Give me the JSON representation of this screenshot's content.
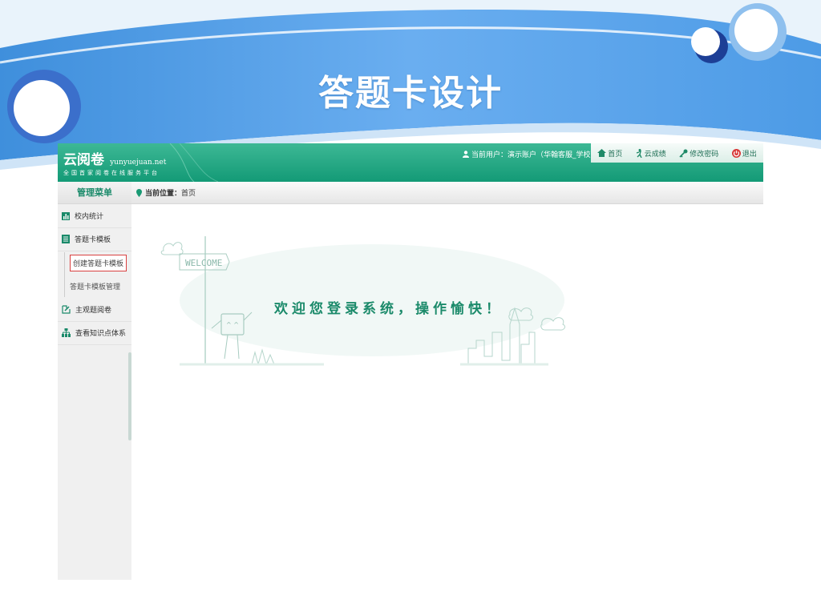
{
  "slide": {
    "title": "答题卡设计"
  },
  "app": {
    "logo": {
      "name": "云阅卷",
      "url": "yunyuejuan.net",
      "tagline": "全国首家阅卷在线服务平台"
    },
    "header": {
      "user_info": "当前用户：演示账户（华翰客服_学校）",
      "nav": [
        "首页",
        "云成绩",
        "修改密码",
        "退出"
      ]
    },
    "menu_title": "管理菜单",
    "breadcrumb": {
      "label": "当前位置：",
      "value": "首页"
    },
    "sidebar": {
      "items": [
        {
          "label": "校内统计",
          "icon": "bar-chart-icon"
        },
        {
          "label": "答题卡模板",
          "icon": "document-list-icon"
        },
        {
          "label": "主观题阅卷",
          "icon": "grading-icon"
        },
        {
          "label": "查看知识点体系",
          "icon": "hierarchy-icon"
        }
      ],
      "subitems": [
        "创建答题卡模板",
        "答题卡模板管理"
      ]
    },
    "welcome": {
      "sign": "WELCOME",
      "message": "欢迎您登录系统，操作愉快！"
    }
  },
  "colors": {
    "header": "#139a76",
    "accent": "#1b8a6a",
    "active_border": "#d94040",
    "slide_banner": "#5aa6e6"
  }
}
